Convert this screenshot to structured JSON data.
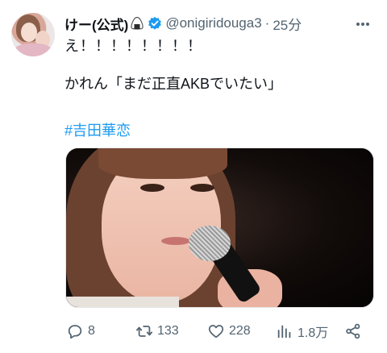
{
  "tweet": {
    "author": {
      "display_name": "けー(公式)",
      "handle": "@onigiridouga3",
      "separator": "·",
      "time": "25分",
      "verified": true,
      "name_emoji": "onigiri-icon"
    },
    "text_line1": "え！！！！！！！！",
    "text_line2": "かれん「まだ正直AKBでいたい」",
    "hashtag": "#吉田華恋",
    "media": {
      "type": "photo",
      "icon": "photo"
    },
    "actions": {
      "reply_count": "8",
      "retweet_count": "133",
      "like_count": "228",
      "view_count": "1.8万"
    }
  },
  "colors": {
    "text": "#0f1419",
    "secondary": "#536471",
    "link": "#1d9bf0",
    "verified": "#1d9bf0"
  }
}
